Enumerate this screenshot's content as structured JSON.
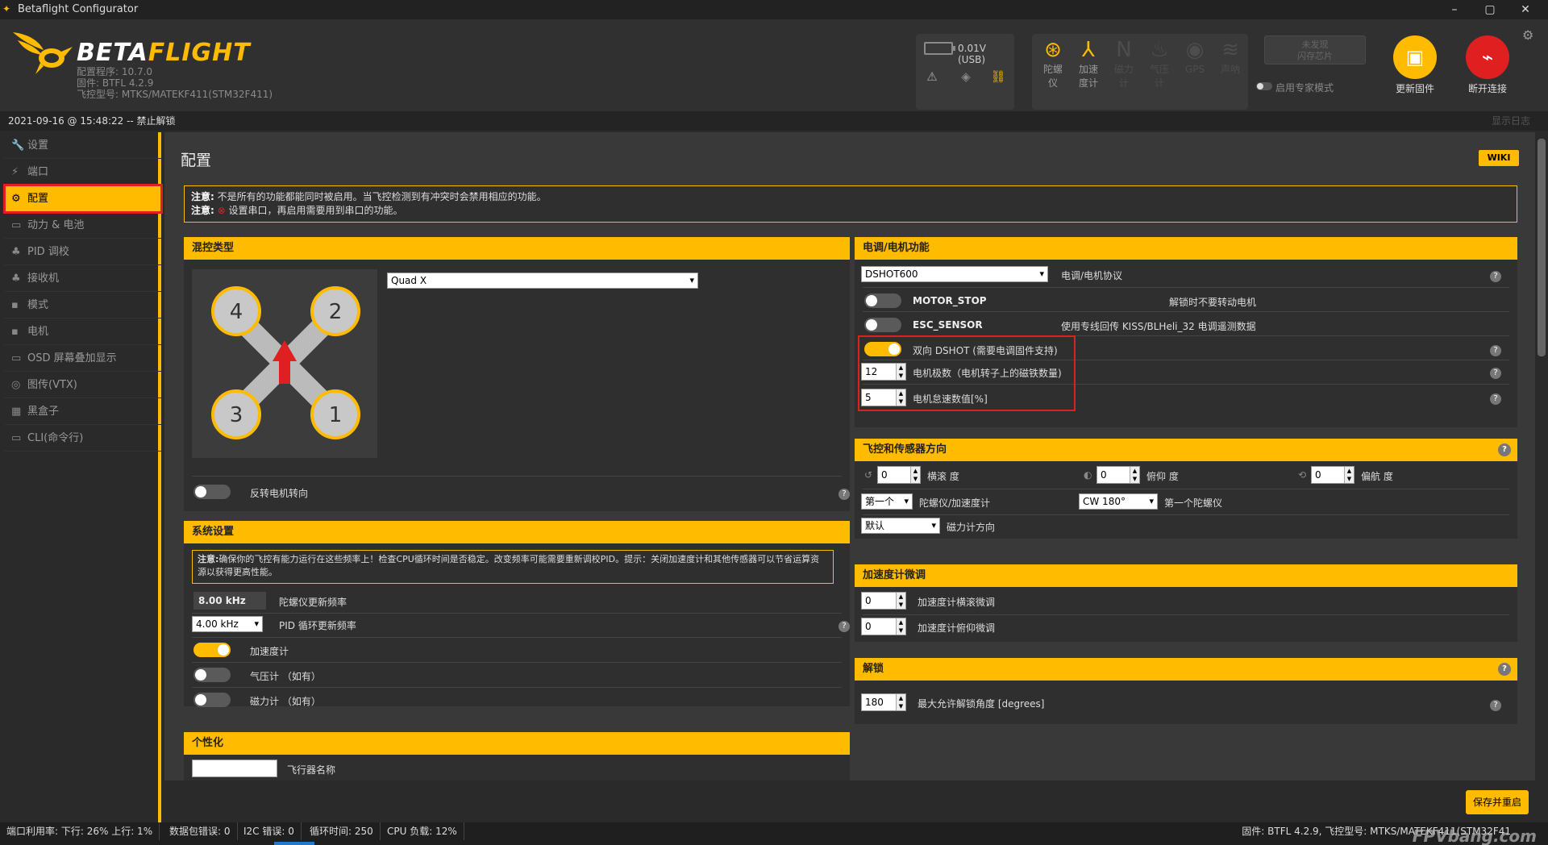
{
  "window": {
    "title": "Betaflight Configurator",
    "minimize": "–",
    "maximize": "▢",
    "close": "✕"
  },
  "header": {
    "brand_a": "BETA",
    "brand_b": "FLIGHT",
    "info": [
      "配置程序: 10.7.0",
      "固件: BTFL 4.2.9",
      "飞控型号: MTKS/MATEKF411(STM32F411)"
    ],
    "battery": "0.01V (USB)",
    "sensors": [
      {
        "label": "陀螺仪",
        "icon": "gyro-icon",
        "glyph": "⊛",
        "on": true
      },
      {
        "label": "加速度计",
        "icon": "accel-icon",
        "glyph": "⅄",
        "on": true
      },
      {
        "label": "磁力计",
        "icon": "mag-icon",
        "glyph": "N",
        "on": false
      },
      {
        "label": "气压计",
        "icon": "baro-icon",
        "glyph": "♨",
        "on": false
      },
      {
        "label": "GPS",
        "icon": "gps-icon",
        "glyph": "◉",
        "on": false
      },
      {
        "label": "声呐",
        "icon": "sonar-icon",
        "glyph": "≋",
        "on": false
      }
    ],
    "flash": [
      "未发现",
      "闪存芯片"
    ],
    "expert_mode": "启用专家模式",
    "update_firmware": "更新固件",
    "disconnect": "断开连接",
    "accent": "#ffbb00",
    "disconnect_color": "#e02020"
  },
  "infobar": {
    "left": "2021-09-16 @ 15:48:22 -- 禁止解锁",
    "right": "显示日志"
  },
  "sidebar": [
    {
      "label": "设置",
      "glyph": "🔧"
    },
    {
      "label": "端口",
      "glyph": "⚡"
    },
    {
      "label": "配置",
      "glyph": "⚙",
      "active": true
    },
    {
      "label": "动力 & 电池",
      "glyph": "▭"
    },
    {
      "label": "PID 调校",
      "glyph": "♣"
    },
    {
      "label": "接收机",
      "glyph": "♣"
    },
    {
      "label": "模式",
      "glyph": "▪"
    },
    {
      "label": "电机",
      "glyph": "▪"
    },
    {
      "label": "OSD 屏幕叠加显示",
      "glyph": "▭"
    },
    {
      "label": "图传(VTX)",
      "glyph": "◎"
    },
    {
      "label": "黑盒子",
      "glyph": "▦"
    },
    {
      "label": "CLI(命令行)",
      "glyph": "▭"
    }
  ],
  "page": {
    "title": "配置",
    "wiki": "WIKI",
    "note_bold": "注意:",
    "note_line1": "不是所有的功能都能同时被启用。当飞控检测到有冲突时会禁用相应的功能。",
    "note_line2": "设置串口，再启用需要用到串口的功能。"
  },
  "mixer": {
    "title": "混控类型",
    "type": "Quad X",
    "motors": [
      "4",
      "2",
      "3",
      "1"
    ],
    "reverse": "反转电机转向"
  },
  "system": {
    "title": "系统设置",
    "note_bold": "注意:",
    "note": "确保你的飞控有能力运行在这些频率上！检查CPU循环时间是否稳定。改变频率可能需要重新调校PID。提示：关闭加速度计和其他传感器可以节省运算资源以获得更高性能。",
    "gyro_freq": "8.00 kHz",
    "gyro_label": "陀螺仪更新频率",
    "pid_freq": "4.00 kHz",
    "pid_label": "PID 循环更新频率",
    "accel": "加速度计",
    "baro": "气压计 （如有）",
    "mag": "磁力计 （如有）"
  },
  "personal": {
    "title": "个性化",
    "craft_name": "飞行器名称"
  },
  "esc": {
    "title": "电调/电机功能",
    "protocol": "DSHOT600",
    "protocol_label": "电调/电机协议",
    "motor_stop": "MOTOR_STOP",
    "motor_stop_desc": "解锁时不要转动电机",
    "esc_sensor": "ESC_SENSOR",
    "esc_sensor_desc": "使用专线回传 KISS/BLHeli_32 电调遥测数据",
    "bidir": "双向 DSHOT (需要电调固件支持)",
    "poles_val": "12",
    "poles_label": "电机极数（电机转子上的磁铁数量)",
    "idle_val": "5",
    "idle_label": "电机怠速数值[%]"
  },
  "orientation": {
    "title": "飞控和传感器方向",
    "roll_val": "0",
    "roll": "横滚 度",
    "pitch_val": "0",
    "pitch": "俯仰 度",
    "yaw_val": "0",
    "yaw": "偏航 度",
    "gyro_sel": "第一个",
    "gyro_sel_label": "陀螺仪/加速度计",
    "gyro_align": "CW 180°",
    "gyro_align_label": "第一个陀螺仪",
    "mag_sel": "默认",
    "mag_label": "磁力计方向"
  },
  "accel_trim": {
    "title": "加速度计微调",
    "roll_val": "0",
    "roll": "加速度计横滚微调",
    "pitch_val": "0",
    "pitch": "加速度计俯仰微调"
  },
  "arming": {
    "title": "解锁",
    "angle_val": "180",
    "angle": "最大允许解锁角度 [degrees]"
  },
  "save": "保存并重启",
  "status": {
    "port": "端口利用率:  下行: 26% 上行: 1%",
    "packet": "数据包错误: 0",
    "i2c": "I2C 错误: 0",
    "cycle": "循环时间: 250",
    "cpu": "CPU 负载: 12%",
    "right": "固件: BTFL 4.2.9, 飞控型号: MTKS/MATEKF411(STM32F41",
    "watermark": "FPVbang.com"
  }
}
